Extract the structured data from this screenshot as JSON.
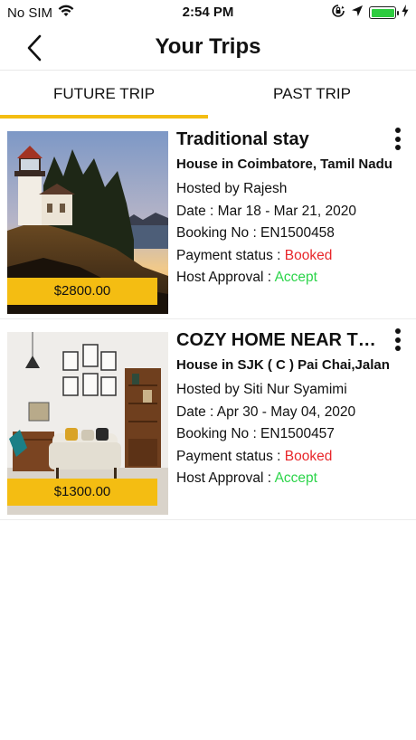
{
  "status_bar": {
    "carrier": "No SIM",
    "time": "2:54 PM",
    "icons": [
      "wifi-icon",
      "orientation-lock-icon",
      "location-icon",
      "battery-icon",
      "charging-icon"
    ],
    "battery_level": 1.0
  },
  "header": {
    "title": "Your Trips",
    "back_icon": "chevron-left-icon"
  },
  "tabs": [
    {
      "label": "FUTURE TRIP",
      "active": true
    },
    {
      "label": "PAST TRIP",
      "active": false
    }
  ],
  "colors": {
    "accent": "#f4bd12",
    "booked": "#e8262a",
    "accept": "#2cd44a"
  },
  "trips": [
    {
      "title": "Traditional stay",
      "subtitle": "House in Coimbatore, Tamil Nadu",
      "host": "Hosted by Rajesh",
      "date": "Date : Mar 18 - Mar 21, 2020",
      "booking": "Booking No : EN1500458",
      "payment_label": "Payment status : ",
      "payment_status": "Booked",
      "approval_label": "Host Approval : ",
      "approval_status": "Accept",
      "price": "$2800.00",
      "image": "lighthouse-photo"
    },
    {
      "title": "COZY HOME NEAR THE CITY",
      "subtitle": "House in SJK ( C ) Pai Chai,Jalan",
      "host": "Hosted by Siti Nur Syamimi",
      "date": "Date : Apr 30 - May 04, 2020",
      "booking": "Booking No : EN1500457",
      "payment_label": "Payment status : ",
      "payment_status": "Booked",
      "approval_label": "Host Approval : ",
      "approval_status": "Accept",
      "price": "$1300.00",
      "image": "living-room-photo"
    }
  ]
}
